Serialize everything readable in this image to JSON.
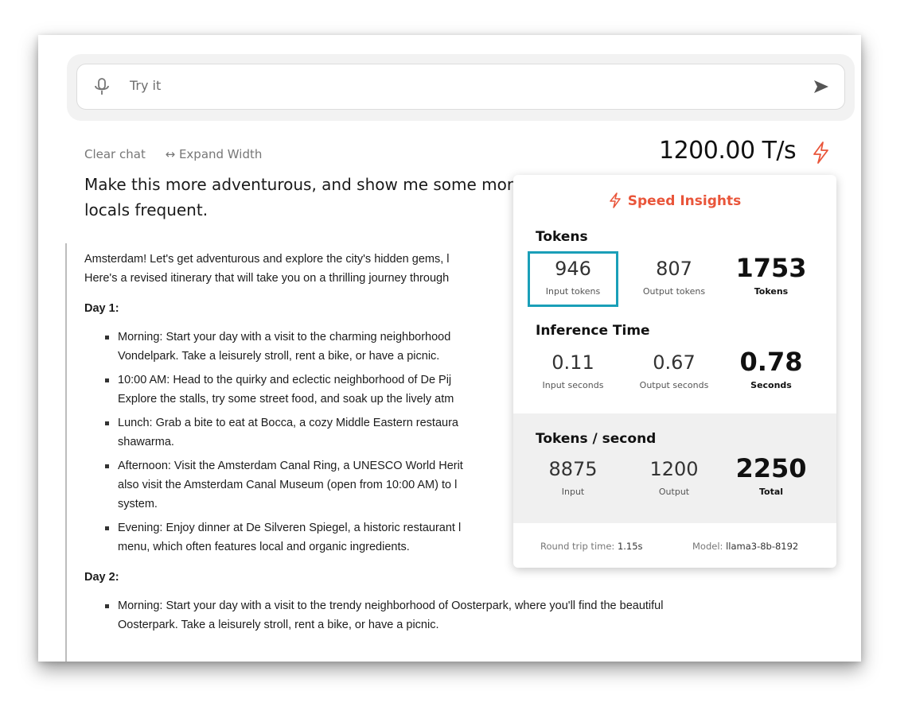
{
  "input": {
    "placeholder": "Try it",
    "mic_icon": "microphone-icon",
    "send_icon": "send-arrow-icon"
  },
  "toolbar": {
    "clear_label": "Clear chat",
    "expand_label": "↔ Expand Width"
  },
  "speed": {
    "value": "1200.00 T/s",
    "icon": "lightning-bolt-icon",
    "accent": "#e9553a"
  },
  "prompt_text": "Make this more adventurous, and show me some mor locals frequent.",
  "response": {
    "intro_1": "Amsterdam! Let's get adventurous and explore the city's hidden gems, l",
    "intro_2": "Here's a revised itinerary that will take you on a thrilling journey through",
    "day1_label": "Day 1:",
    "day1_items": [
      "Morning: Start your day with a visit to the charming neighborhood",
      "Vondelpark. Take a leisurely stroll, rent a bike, or have a picnic.",
      "10:00 AM: Head to the quirky and eclectic neighborhood of De Pij",
      "Explore the stalls, try some street food, and soak up the lively atm",
      "Lunch: Grab a bite to eat at Bocca, a cozy Middle Eastern restaura",
      "shawarma.",
      "Afternoon: Visit the Amsterdam Canal Ring, a UNESCO World Herit",
      "also visit the Amsterdam Canal Museum (open from 10:00 AM) to l",
      "system.",
      "Evening: Enjoy dinner at De Silveren Spiegel, a historic restaurant l",
      "menu, which often features local and organic ingredients."
    ],
    "day2_label": "Day 2:",
    "day2_items": [
      "Morning: Start your day with a visit to the trendy neighborhood of Oosterpark, where you'll find the beautiful",
      "Oosterpark. Take a leisurely stroll, rent a bike, or have a picnic."
    ]
  },
  "insights": {
    "title": "Speed Insights",
    "tokens": {
      "label": "Tokens",
      "input": "946",
      "input_label": "Input tokens",
      "output": "807",
      "output_label": "Output tokens",
      "total": "1753",
      "total_label": "Tokens"
    },
    "inference": {
      "label": "Inference Time",
      "input": "0.11",
      "input_label": "Input seconds",
      "output": "0.67",
      "output_label": "Output seconds",
      "total": "0.78",
      "total_label": "Seconds"
    },
    "tps": {
      "label": "Tokens / second",
      "input": "8875",
      "input_label": "Input",
      "output": "1200",
      "output_label": "Output",
      "total": "2250",
      "total_label": "Total"
    },
    "footer": {
      "rtt_label": "Round trip time:",
      "rtt_value": "1.15s",
      "model_label": "Model:",
      "model_value": "llama3-8b-8192"
    },
    "highlight_color": "#1a9fb8"
  }
}
